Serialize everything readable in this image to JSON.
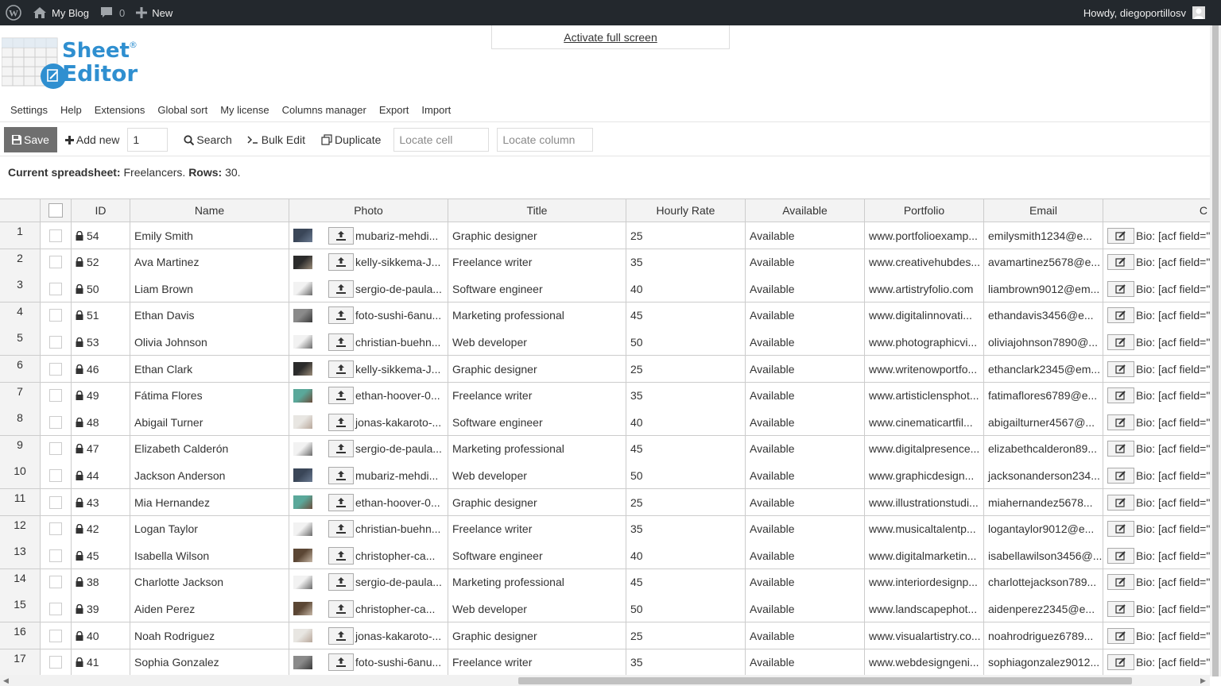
{
  "adminbar": {
    "site_name": "My Blog",
    "comments_count": "0",
    "new_label": "New",
    "howdy": "Howdy, diegoportillosv"
  },
  "fullscreen_link": "Activate full screen",
  "logo": {
    "word1": "Sheet",
    "word2": "Editor",
    "reg": "®"
  },
  "menu": [
    "Settings",
    "Help",
    "Extensions",
    "Global sort",
    "My license",
    "Columns manager",
    "Export",
    "Import"
  ],
  "toolbar": {
    "save": "Save",
    "add_new": "Add new",
    "add_count": "1",
    "search": "Search",
    "bulk_edit": "Bulk Edit",
    "duplicate": "Duplicate",
    "locate_cell": "Locate cell",
    "locate_column": "Locate column"
  },
  "status": {
    "label": "Current spreadsheet:",
    "sheet": "Freelancers.",
    "rows_label": "Rows:",
    "rows": "30."
  },
  "columns": [
    "ID",
    "Name",
    "Photo",
    "Title",
    "Hourly Rate",
    "Available",
    "Portfolio",
    "Email",
    "C"
  ],
  "colors": {
    "adminbar": "#23282d",
    "save_btn": "#6f6f6f",
    "logo_blue": "#2f8fd0"
  },
  "rows": [
    {
      "n": "1",
      "id": "54",
      "name": "Emily Smith",
      "photo": "mubariz-mehdi...",
      "thumb": "dark",
      "title": "Graphic designer",
      "rate": "25",
      "avail": "Available",
      "portfolio": "www.portfolioexamp...",
      "email": "emilysmith1234@e...",
      "bio": "Bio: [acf field=\""
    },
    {
      "n": "2",
      "id": "52",
      "name": "Ava Martinez",
      "photo": "kelly-sikkema-J...",
      "thumb": "woman",
      "title": "Freelance writer",
      "rate": "35",
      "avail": "Available",
      "portfolio": "www.creativehubdes...",
      "email": "avamartinez5678@e...",
      "bio": "Bio: [acf field=\""
    },
    {
      "n": "3",
      "id": "50",
      "name": "Liam Brown",
      "photo": "sergio-de-paula...",
      "thumb": "light",
      "title": "Software engineer",
      "rate": "40",
      "avail": "Available",
      "portfolio": "www.artistryfolio.com",
      "email": "liambrown9012@em...",
      "bio": "Bio: [acf field=\""
    },
    {
      "n": "4",
      "id": "51",
      "name": "Ethan Davis",
      "photo": "foto-sushi-6anu...",
      "thumb": "gray",
      "title": "Marketing professional",
      "rate": "45",
      "avail": "Available",
      "portfolio": "www.digitalinnovati...",
      "email": "ethandavis3456@e...",
      "bio": "Bio: [acf field=\""
    },
    {
      "n": "5",
      "id": "53",
      "name": "Olivia Johnson",
      "photo": "christian-buehn...",
      "thumb": "light",
      "title": "Web developer",
      "rate": "50",
      "avail": "Available",
      "portfolio": "www.photographicvi...",
      "email": "oliviajohnson7890@...",
      "bio": "Bio: [acf field=\""
    },
    {
      "n": "6",
      "id": "46",
      "name": "Ethan Clark",
      "photo": "kelly-sikkema-J...",
      "thumb": "woman",
      "title": "Graphic designer",
      "rate": "25",
      "avail": "Available",
      "portfolio": "www.writenowportfo...",
      "email": "ethanclark2345@em...",
      "bio": "Bio: [acf field=\""
    },
    {
      "n": "7",
      "id": "49",
      "name": "Fátima Flores",
      "photo": "ethan-hoover-0...",
      "thumb": "teal",
      "title": "Freelance writer",
      "rate": "35",
      "avail": "Available",
      "portfolio": "www.artisticlensphot...",
      "email": "fatimaflores6789@e...",
      "bio": "Bio: [acf field=\""
    },
    {
      "n": "8",
      "id": "48",
      "name": "Abigail Turner",
      "photo": "jonas-kakaroto-...",
      "thumb": "pale",
      "title": "Software engineer",
      "rate": "40",
      "avail": "Available",
      "portfolio": "www.cinematicartfil...",
      "email": "abigailturner4567@...",
      "bio": "Bio: [acf field=\""
    },
    {
      "n": "9",
      "id": "47",
      "name": "Elizabeth Calderón",
      "photo": "sergio-de-paula...",
      "thumb": "light",
      "title": "Marketing professional",
      "rate": "45",
      "avail": "Available",
      "portfolio": "www.digitalpresence...",
      "email": "elizabethcalderon89...",
      "bio": "Bio: [acf field=\""
    },
    {
      "n": "10",
      "id": "44",
      "name": "Jackson Anderson",
      "photo": "mubariz-mehdi...",
      "thumb": "dark",
      "title": "Web developer",
      "rate": "50",
      "avail": "Available",
      "portfolio": "www.graphicdesign...",
      "email": "jacksonanderson234...",
      "bio": "Bio: [acf field=\""
    },
    {
      "n": "11",
      "id": "43",
      "name": "Mia Hernandez",
      "photo": "ethan-hoover-0...",
      "thumb": "teal",
      "title": "Graphic designer",
      "rate": "25",
      "avail": "Available",
      "portfolio": "www.illustrationstudi...",
      "email": "miahernandez5678...",
      "bio": "Bio: [acf field=\""
    },
    {
      "n": "12",
      "id": "42",
      "name": "Logan Taylor",
      "photo": "christian-buehn...",
      "thumb": "light",
      "title": "Freelance writer",
      "rate": "35",
      "avail": "Available",
      "portfolio": "www.musicaltalentp...",
      "email": "logantaylor9012@e...",
      "bio": "Bio: [acf field=\""
    },
    {
      "n": "13",
      "id": "45",
      "name": "Isabella Wilson",
      "photo": "christopher-ca...",
      "thumb": "brown",
      "title": "Software engineer",
      "rate": "40",
      "avail": "Available",
      "portfolio": "www.digitalmarketin...",
      "email": "isabellawilson3456@...",
      "bio": "Bio: [acf field=\""
    },
    {
      "n": "14",
      "id": "38",
      "name": "Charlotte Jackson",
      "photo": "sergio-de-paula...",
      "thumb": "light",
      "title": "Marketing professional",
      "rate": "45",
      "avail": "Available",
      "portfolio": "www.interiordesignp...",
      "email": "charlottejackson789...",
      "bio": "Bio: [acf field=\""
    },
    {
      "n": "15",
      "id": "39",
      "name": "Aiden Perez",
      "photo": "christopher-ca...",
      "thumb": "brown",
      "title": "Web developer",
      "rate": "50",
      "avail": "Available",
      "portfolio": "www.landscapephot...",
      "email": "aidenperez2345@e...",
      "bio": "Bio: [acf field=\""
    },
    {
      "n": "16",
      "id": "40",
      "name": "Noah Rodriguez",
      "photo": "jonas-kakaroto-...",
      "thumb": "pale",
      "title": "Graphic designer",
      "rate": "25",
      "avail": "Available",
      "portfolio": "www.visualartistry.co...",
      "email": "noahrodriguez6789...",
      "bio": "Bio: [acf field=\""
    },
    {
      "n": "17",
      "id": "41",
      "name": "Sophia Gonzalez",
      "photo": "foto-sushi-6anu...",
      "thumb": "gray",
      "title": "Freelance writer",
      "rate": "35",
      "avail": "Available",
      "portfolio": "www.webdesigngeni...",
      "email": "sophiagonzalez9012...",
      "bio": "Bio: [acf field=\""
    }
  ]
}
